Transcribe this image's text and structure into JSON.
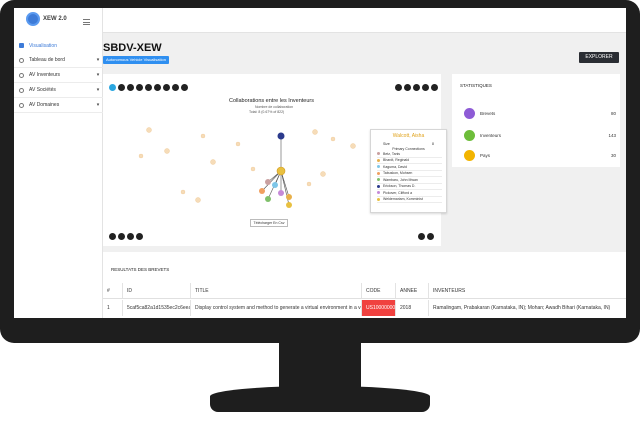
{
  "app": {
    "logo_text": "XEW 2.0"
  },
  "sidebar": {
    "items": [
      {
        "label": "Visualisation",
        "chevron": ""
      },
      {
        "label": "Tableau de bord",
        "chevron": "▾"
      },
      {
        "label": "AV Inventeurs",
        "chevron": "▾"
      },
      {
        "label": "AV Sociétés",
        "chevron": "▾"
      },
      {
        "label": "AV Domaines",
        "chevron": "▾"
      }
    ]
  },
  "page": {
    "title": "SBDV-XEW",
    "badge": "Autonomous Vehicle Visualisation",
    "explore_label": "EXPLORER"
  },
  "graph": {
    "title": "Collaborations entre les Inventeurs",
    "subtitle": "Nombre de collaboration",
    "total": "Total: 8 (0.67% of 822)",
    "download_label": "Télécharger En Csv",
    "popup": {
      "name": "Walcott, Aisha",
      "size_label": "Size",
      "size_value": "8",
      "connections_label": "Primary Connections",
      "connections": [
        {
          "name": "Betz, Tanis",
          "color": "#c9a0a0"
        },
        {
          "name": "Bhardt, Reginald",
          "color": "#e8b04a"
        },
        {
          "name": "Kaguma, David",
          "color": "#7ec6e8"
        },
        {
          "name": "Tabuskon, Mohsen",
          "color": "#f0a060"
        },
        {
          "name": "Wambaru, John Mwan",
          "color": "#7fc06a"
        },
        {
          "name": "Erickson, Thomas D.",
          "color": "#2b3a8c"
        },
        {
          "name": "Pickover, Clifford a",
          "color": "#c58ad8"
        },
        {
          "name": "Weldemariam, Komminist",
          "color": "#e8c040"
        }
      ]
    }
  },
  "stats": {
    "title": "STATISTIQUES",
    "items": [
      {
        "label": "Brevets",
        "value": "80",
        "color": "#8e5bd6"
      },
      {
        "label": "Inventeurs",
        "value": "143",
        "color": "#6dbd3a"
      },
      {
        "label": "Pays",
        "value": "30",
        "color": "#f2b400"
      }
    ]
  },
  "results": {
    "title": "RESULTATS DES BREVETS",
    "columns": [
      "#",
      "ID",
      "TITLE",
      "CODE",
      "ANNEE",
      "INVENTEURS"
    ],
    "rows": [
      {
        "num": "1",
        "id": "5caf5ca82a1d1535ec2c6eea",
        "title": "Display control system and method to generate a virtual environment in a vehicle",
        "code": "US10000000",
        "year": "2018",
        "inventors": "Ramalingam, Prabakaran (Karnataka, IN); Mohan; Awadh Bihari (Karnataka, IN)"
      }
    ]
  },
  "colors": {
    "accent": "#3d7bd8",
    "badge": "#2f8ff0",
    "code_cell": "#f0413f",
    "popup_title": "#e0a21a"
  }
}
